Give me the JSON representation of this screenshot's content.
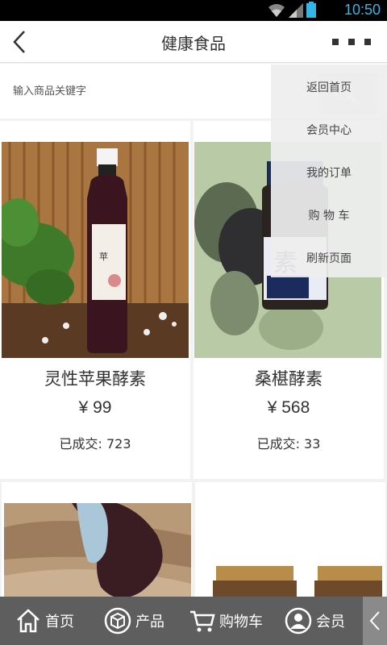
{
  "status_bar": {
    "time": "10:50"
  },
  "header": {
    "title": "健康食品"
  },
  "search": {
    "placeholder": "输入商品关键字"
  },
  "products": [
    {
      "name": "灵性苹果酵素",
      "price": "¥ 99",
      "sold": "已成交: 723",
      "label_text": "苹果酵素"
    },
    {
      "name": "桑椹酵素",
      "price": "¥ 568",
      "sold": "已成交: 33",
      "label_text": "素"
    },
    {
      "name": "",
      "price": "",
      "sold": ""
    },
    {
      "name": "",
      "price": "",
      "sold": ""
    }
  ],
  "menu": {
    "items": [
      {
        "label": "返回首页"
      },
      {
        "label": "会员中心"
      },
      {
        "label": "我的订单"
      },
      {
        "label": "购 物 车"
      },
      {
        "label": "刷新页面"
      }
    ]
  },
  "bottom_nav": {
    "items": [
      {
        "label": "首页",
        "icon": "home-icon"
      },
      {
        "label": "产品",
        "icon": "cube-icon"
      },
      {
        "label": "购物车",
        "icon": "cart-icon"
      },
      {
        "label": "会员",
        "icon": "user-icon"
      }
    ]
  },
  "colors": {
    "accent_time": "#33b5e5",
    "nav_bg": "#5e5e5e",
    "header_bg": "#ffffff"
  }
}
